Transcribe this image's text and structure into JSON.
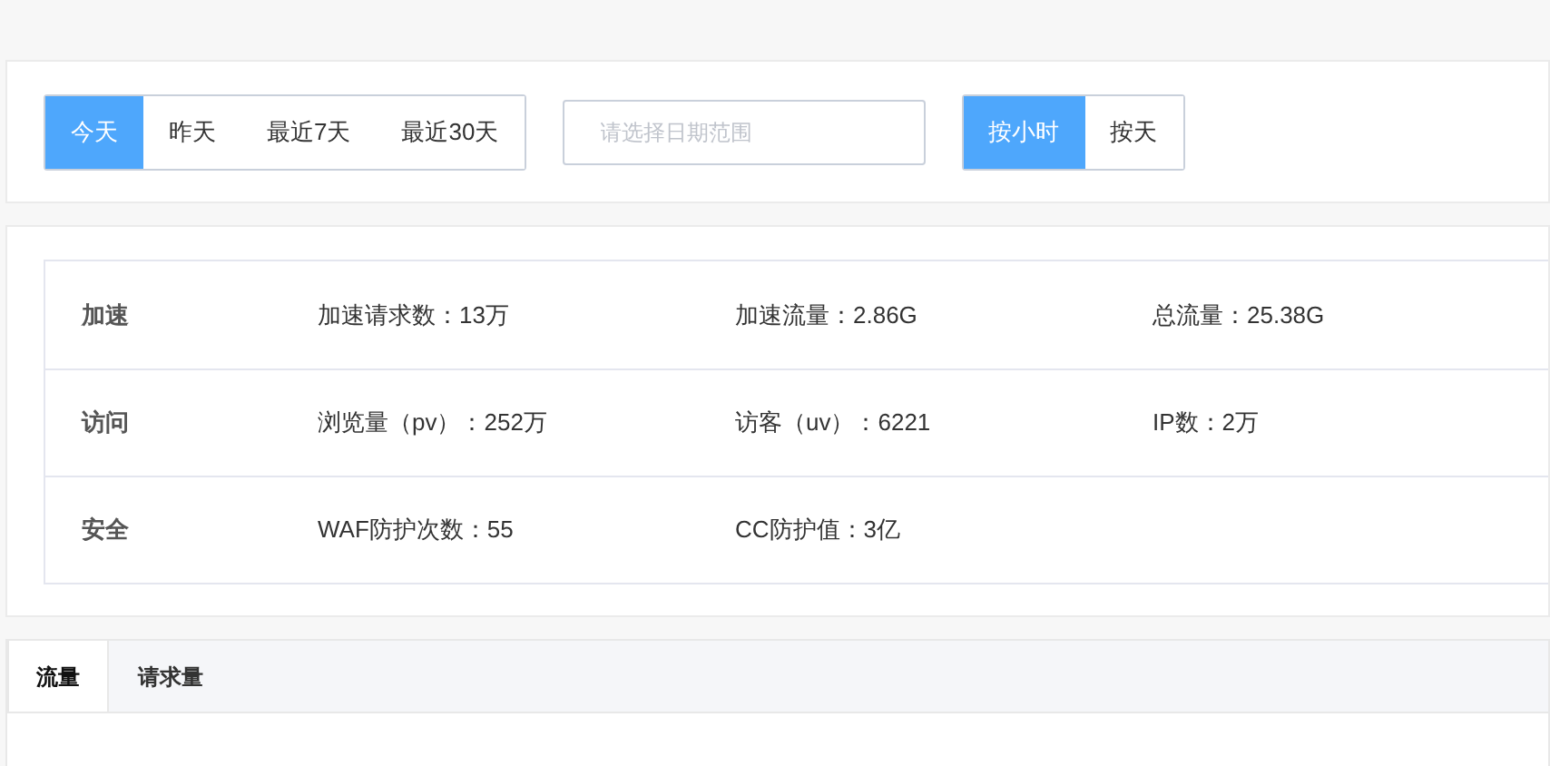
{
  "range_buttons": [
    {
      "label": "今天",
      "selected": true
    },
    {
      "label": "昨天",
      "selected": false
    },
    {
      "label": "最近7天",
      "selected": false
    },
    {
      "label": "最近30天",
      "selected": false
    }
  ],
  "date_range": {
    "placeholder": "请选择日期范围"
  },
  "granularity": [
    {
      "label": "按小时",
      "selected": true
    },
    {
      "label": "按天",
      "selected": false
    }
  ],
  "stats": [
    {
      "category": "加速",
      "items": [
        "加速请求数：13万",
        "加速流量：2.86G",
        "总流量：25.38G"
      ]
    },
    {
      "category": "访问",
      "items": [
        "浏览量（pv）：252万",
        "访客（uv）：6221",
        "IP数：2万"
      ]
    },
    {
      "category": "安全",
      "items": [
        "WAF防护次数：55",
        "CC防护值：3亿"
      ]
    }
  ],
  "tabs": [
    {
      "label": "流量",
      "selected": true
    },
    {
      "label": "请求量",
      "selected": false
    }
  ]
}
